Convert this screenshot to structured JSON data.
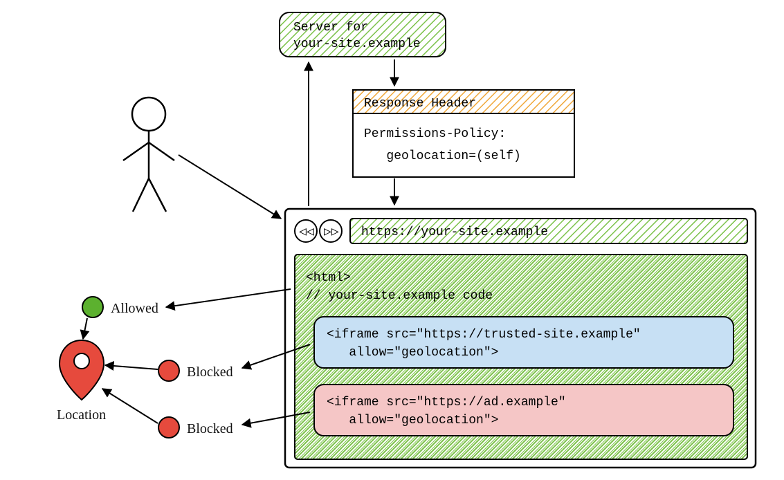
{
  "server": {
    "line1": "Server for",
    "line2": "your-site.example"
  },
  "response_header": {
    "title": "Response Header",
    "line1": "Permissions-Policy:",
    "line2": "   geolocation=(self)"
  },
  "browser": {
    "url": "https://your-site.example",
    "html_label": "<html>",
    "comment": "// your-site.example code",
    "iframe_trusted": {
      "line1": "<iframe src=\"https://trusted-site.example\"",
      "line2": "   allow=\"geolocation\">"
    },
    "iframe_ad": {
      "line1": "<iframe src=\"https://ad.example\"",
      "line2": "   allow=\"geolocation\">"
    }
  },
  "status": {
    "allowed": "Allowed",
    "blocked1": "Blocked",
    "blocked2": "Blocked"
  },
  "location_label": "Location",
  "colors": {
    "hatch_green": "#7cc24a",
    "hatch_orange": "#f0a83a",
    "dot_green": "#5cb12f",
    "dot_red": "#e64a3d",
    "pin_red": "#e64a3d",
    "iframe_blue": "#c7e0f4",
    "iframe_pink": "#f5c6c6"
  }
}
